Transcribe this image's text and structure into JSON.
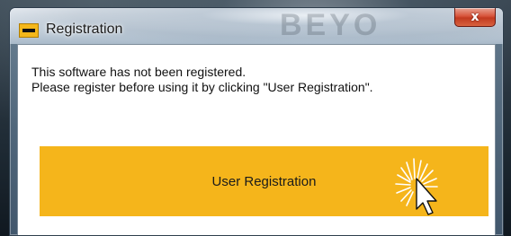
{
  "window": {
    "title": "Registration",
    "watermark": "BEYO",
    "close_label": "x"
  },
  "dialog": {
    "message_line1": "This software has not been registered.",
    "message_line2": "Please register before using it by clicking \"User Registration\".",
    "register_button_label": "User Registration"
  },
  "icons": {
    "app": "dewalt-logo-icon",
    "close": "close-icon",
    "cursor": "mouse-pointer-click-icon"
  },
  "colors": {
    "button_bg": "#f5b51b",
    "close_bg": "#c9452a",
    "logo_bg": "#f4b71a"
  }
}
